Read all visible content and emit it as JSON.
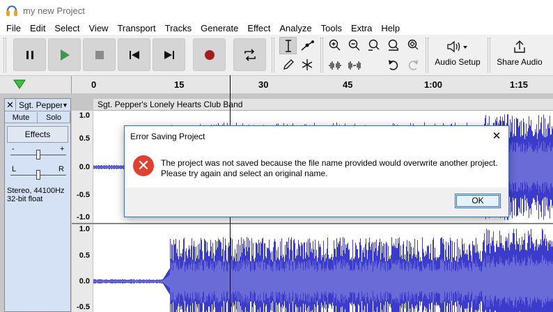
{
  "window": {
    "title": "my new Project"
  },
  "menu": [
    "File",
    "Edit",
    "Select",
    "View",
    "Transport",
    "Tracks",
    "Generate",
    "Effect",
    "Analyze",
    "Tools",
    "Extra",
    "Help"
  ],
  "toolbar": {
    "audio_setup_label": "Audio Setup",
    "share_audio_label": "Share Audio"
  },
  "timeline": {
    "ticks": [
      "0",
      "15",
      "30",
      "45",
      "1:00",
      "1:15"
    ]
  },
  "track": {
    "name": "Sgt. Pepper'",
    "mute_label": "Mute",
    "solo_label": "Solo",
    "effects_label": "Effects",
    "gain_minus": "-",
    "gain_plus": "+",
    "pan_left": "L",
    "pan_right": "R",
    "info_line1": "Stereo, 44100Hz",
    "info_line2": "32-bit float",
    "clip_name": "Sgt. Pepper's Lonely Hearts Club Band",
    "scale_top": [
      "1.0",
      "0.5",
      "0.0",
      "-0.5",
      "-1.0"
    ],
    "scale_bottom": [
      "1.0",
      "0.5",
      "0.0",
      "-0.5"
    ]
  },
  "dialog": {
    "title": "Error Saving Project",
    "close_glyph": "✕",
    "line1": "The project was not saved because the file name provided would overwrite another project.",
    "line2": "Please try again and select an original name.",
    "ok_label": "OK"
  },
  "colors": {
    "waveform": "#3b3bcc",
    "waveform_rms": "#6b6bd8",
    "error_icon": "#e2402e",
    "accent": "#2b6fd6"
  }
}
